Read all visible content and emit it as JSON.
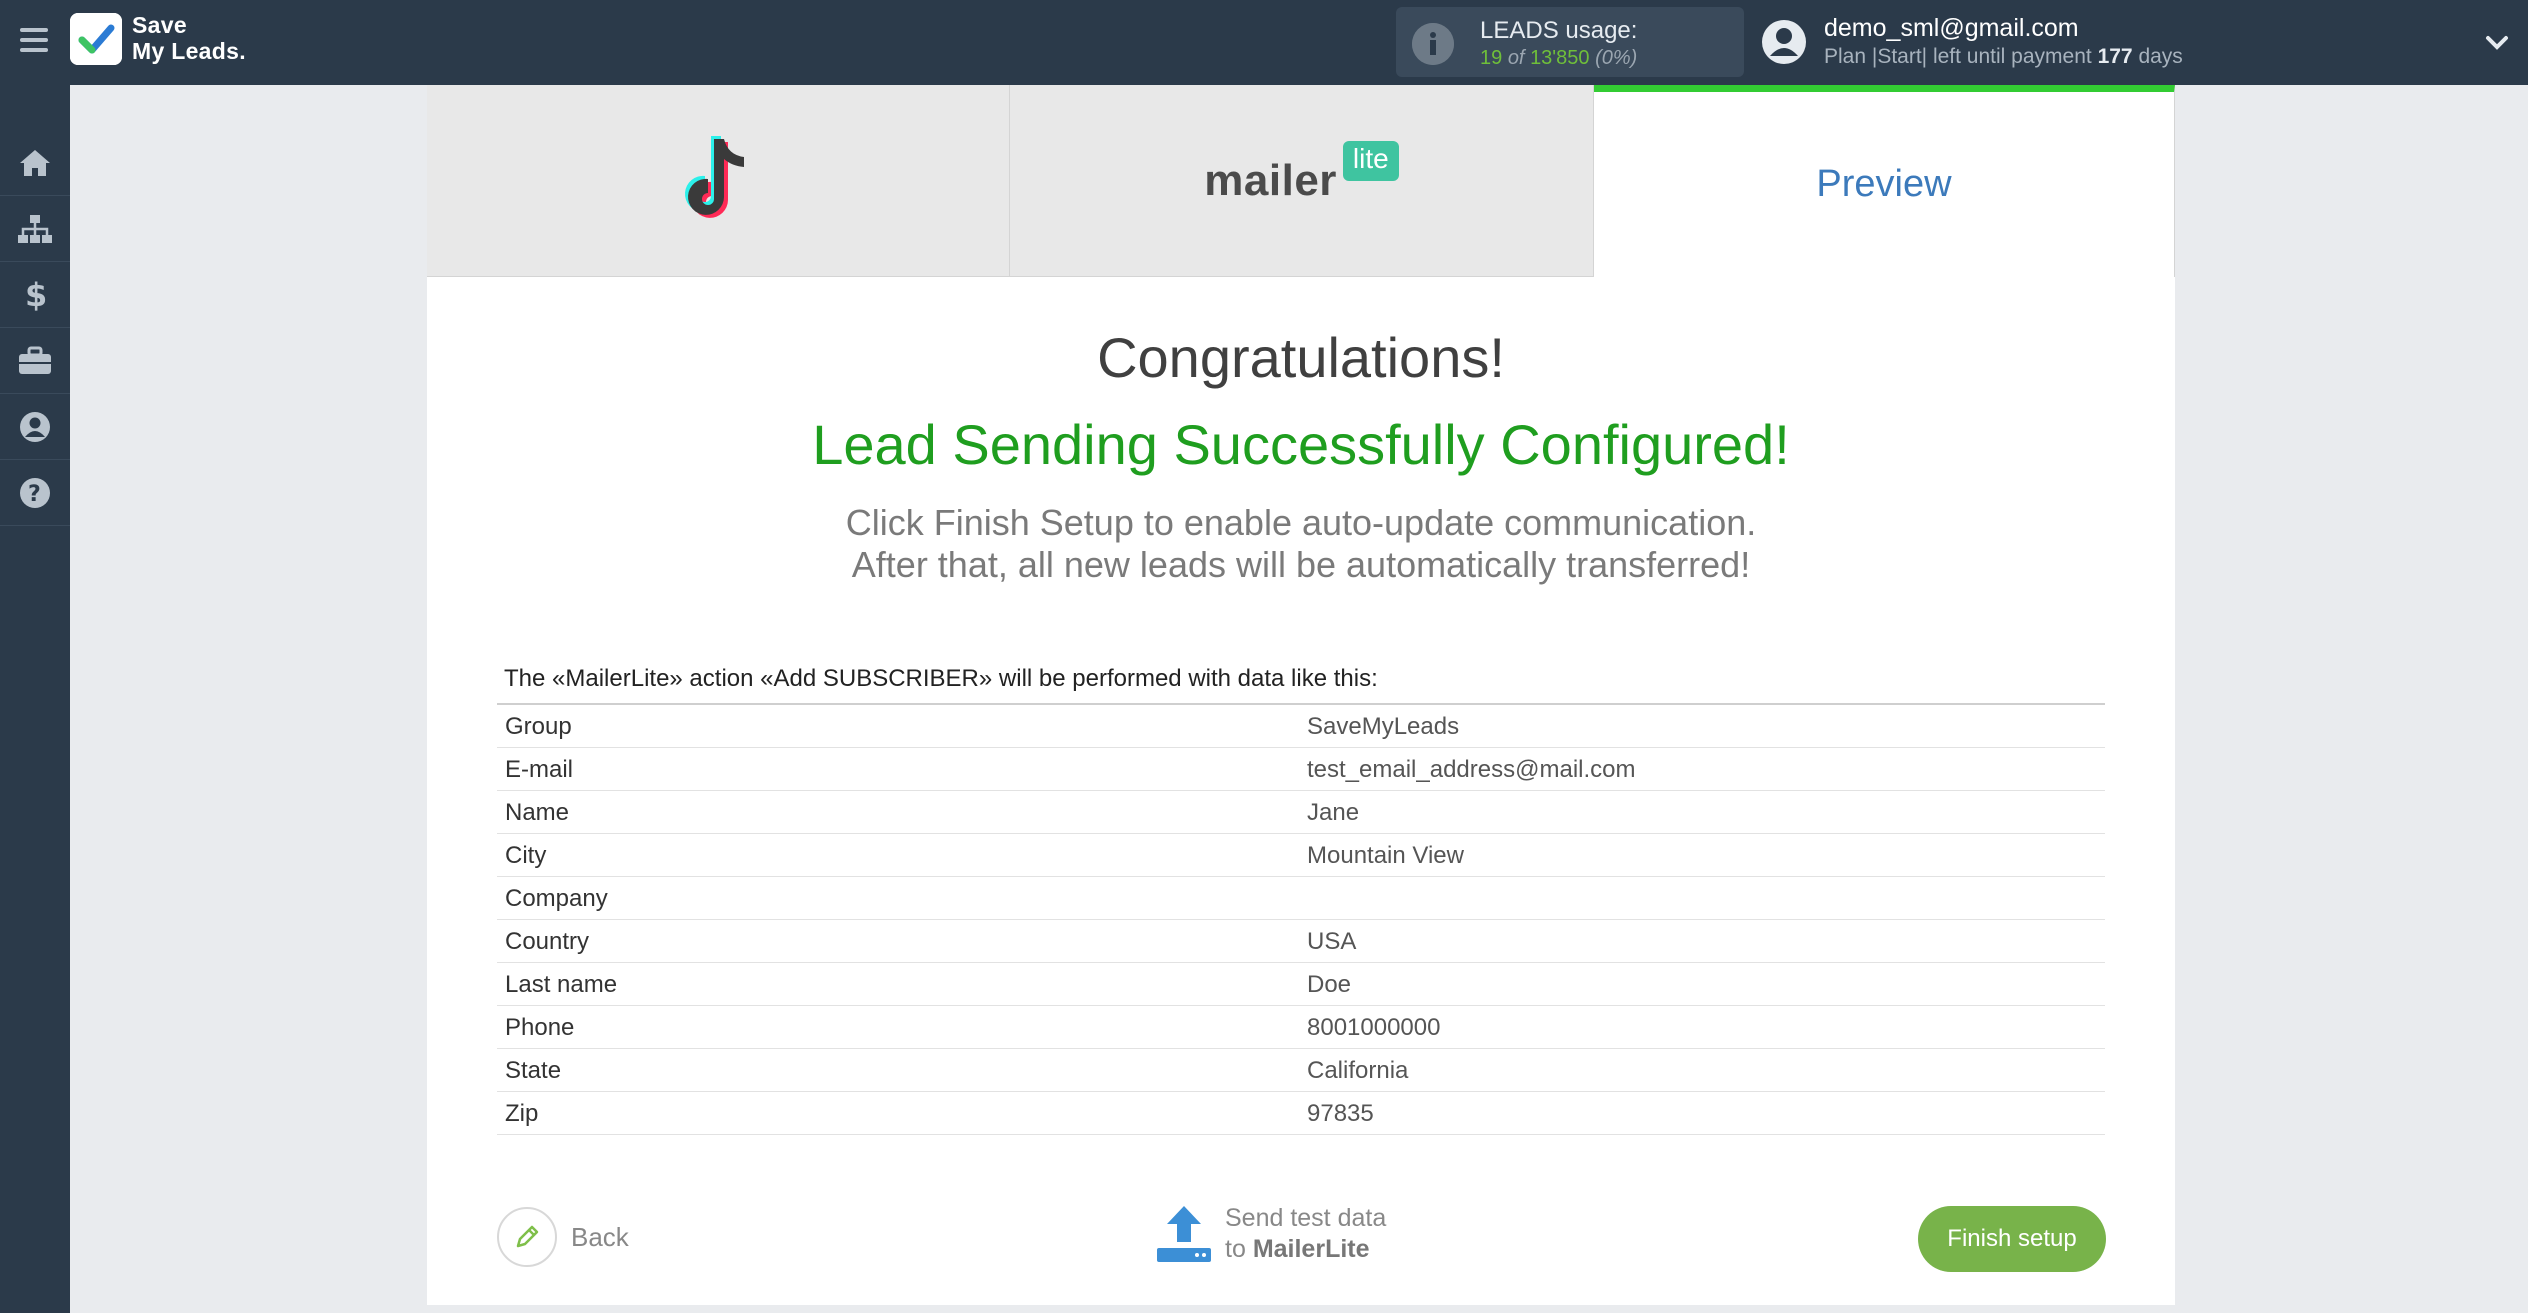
{
  "header": {
    "logo_text_line1": "Save",
    "logo_text_line2": "My Leads.",
    "usage_title": "LEADS usage:",
    "usage_count": "19",
    "usage_of": "of",
    "usage_total": "13'850",
    "usage_percent": "(0%)",
    "user_email": "demo_sml@gmail.com",
    "plan_prefix": "Plan |Start| left until payment",
    "plan_days": "177",
    "plan_suffix": "days"
  },
  "sidebar": {
    "items": [
      {
        "icon": "home-icon"
      },
      {
        "icon": "sitemap-icon"
      },
      {
        "icon": "dollar-icon"
      },
      {
        "icon": "briefcase-icon"
      },
      {
        "icon": "user-circle-icon"
      },
      {
        "icon": "help-icon"
      }
    ]
  },
  "tabs": {
    "source": "TikTok",
    "destination_word": "mailer",
    "destination_badge": "lite",
    "preview_label": "Preview"
  },
  "main": {
    "title": "Congratulations!",
    "success_message": "Lead Sending Successfully Configured!",
    "info_line1": "Click Finish Setup to enable auto-update communication.",
    "info_line2": "After that, all new leads will be automatically transferred!",
    "table_caption": "The «MailerLite» action «Add SUBSCRIBER» will be performed with data like this:",
    "rows": [
      {
        "key": "Group",
        "value": "SaveMyLeads"
      },
      {
        "key": "E-mail",
        "value": "test_email_address@mail.com"
      },
      {
        "key": "Name",
        "value": "Jane"
      },
      {
        "key": "City",
        "value": "Mountain View"
      },
      {
        "key": "Company",
        "value": ""
      },
      {
        "key": "Country",
        "value": "USA"
      },
      {
        "key": "Last name",
        "value": "Doe"
      },
      {
        "key": "Phone",
        "value": "8001000000"
      },
      {
        "key": "State",
        "value": "California"
      },
      {
        "key": "Zip",
        "value": "97835"
      }
    ]
  },
  "footer": {
    "back_label": "Back",
    "send_test_line1": "Send test data",
    "send_test_prefix": "to",
    "send_test_target": "MailerLite",
    "finish_label": "Finish setup"
  },
  "colors": {
    "topbar": "#2b3a4a",
    "success_green": "#1f9e1f",
    "finish_button": "#78b34a",
    "active_tab_border": "#33cc33",
    "preview_blue": "#3c7abb"
  }
}
